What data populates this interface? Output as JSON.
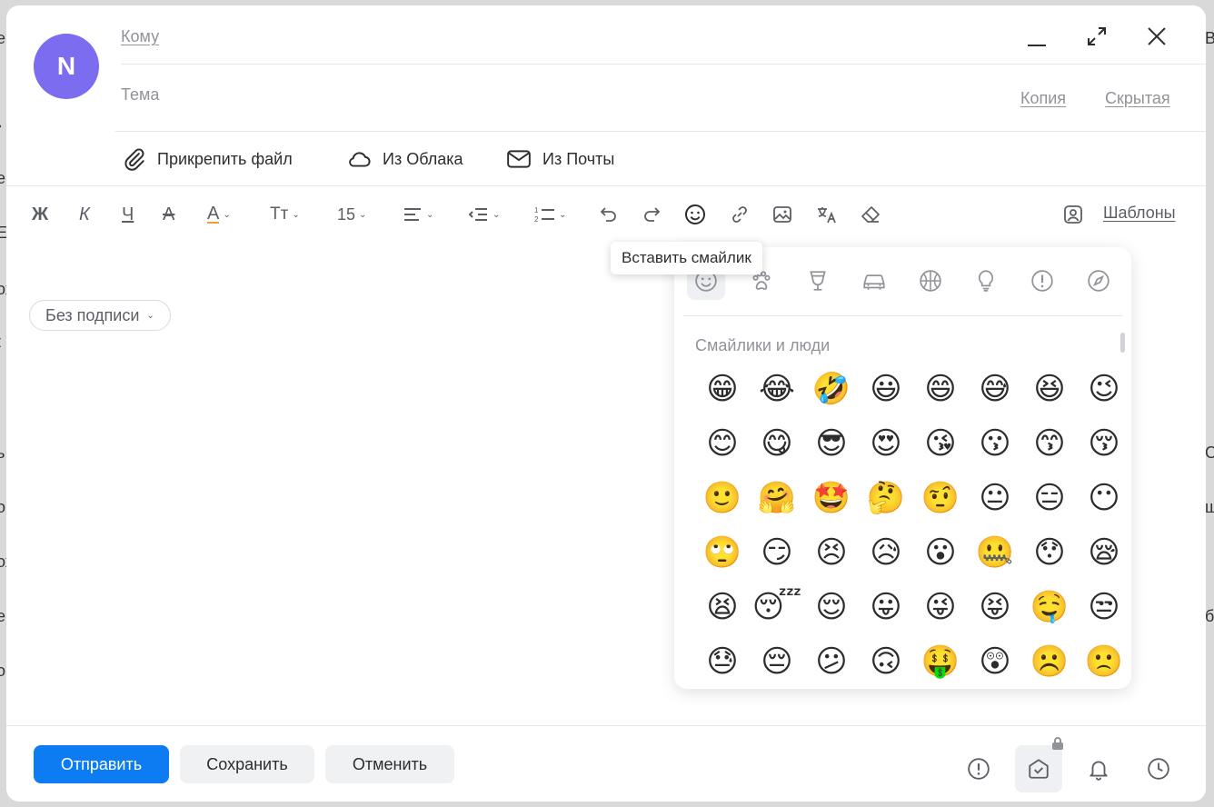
{
  "background": {
    "left_glyphs": [
      "е",
      "›",
      "е",
      "Е",
      "ох",
      "t",
      "ь",
      "о",
      "ох",
      "е",
      "о"
    ],
    "right_glyphs": [
      "В",
      "Оч",
      "ш",
      "б"
    ]
  },
  "header": {
    "avatar_letter": "N",
    "to_label": "Кому",
    "subject_label": "Тема",
    "cc_label": "Копия",
    "bcc_label": "Скрытая"
  },
  "attachments": {
    "attach_file": "Прикрепить файл",
    "from_cloud": "Из Облака",
    "from_mail": "Из Почты"
  },
  "toolbar": {
    "bold": "Ж",
    "italic": "К",
    "underline": "Ч",
    "strike": "А",
    "text_color": "А",
    "font_style": "Тт",
    "font_size": "15",
    "templates": "Шаблоны"
  },
  "tooltip": "Вставить смайлик",
  "signature": {
    "label": "Без подписи"
  },
  "emoji_panel": {
    "section_title": "Смайлики и люди",
    "categories": [
      "smileys",
      "animals",
      "food",
      "travel",
      "activities",
      "objects",
      "symbols",
      "flags"
    ],
    "emojis": [
      "😁",
      "😂",
      "🤣",
      "😃",
      "😄",
      "😅",
      "😆",
      "😉",
      "😊",
      "😋",
      "😎",
      "😍",
      "😘",
      "😗",
      "😙",
      "😚",
      "🙂",
      "🤗",
      "🤩",
      "🤔",
      "🤨",
      "😐",
      "😑",
      "😶",
      "🙄",
      "😏",
      "😣",
      "😥",
      "😮",
      "🤐",
      "😯",
      "😪",
      "😫",
      "😴",
      "😌",
      "😛",
      "😜",
      "😝",
      "🤤",
      "😒",
      "😓",
      "😔",
      "😕",
      "🙃",
      "🤑",
      "😲",
      "☹️",
      "🙁"
    ]
  },
  "footer": {
    "send": "Отправить",
    "save": "Сохранить",
    "cancel": "Отменить"
  }
}
